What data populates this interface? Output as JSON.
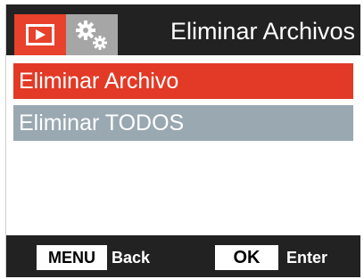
{
  "header": {
    "title": "Eliminar Archivos",
    "tabs": [
      {
        "icon": "playback-icon",
        "active": true
      },
      {
        "icon": "gears-icon",
        "active": false
      }
    ]
  },
  "menu": {
    "items": [
      {
        "label": "Eliminar Archivo",
        "selected": true
      },
      {
        "label": "Eliminar TODOS",
        "selected": false
      }
    ]
  },
  "footer": {
    "menu_key": "MENU",
    "menu_action": "Back",
    "ok_key": "OK",
    "ok_action": "Enter"
  },
  "colors": {
    "accent": "#e23a26",
    "unselected_item": "#9aa8b1",
    "bar": "#222222"
  }
}
